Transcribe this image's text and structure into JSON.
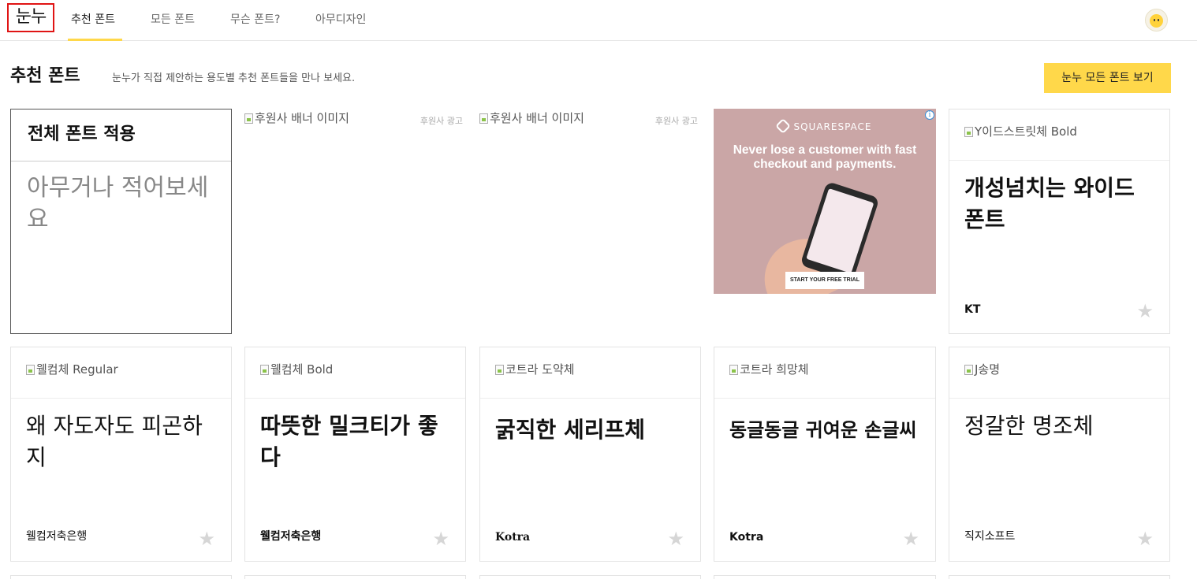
{
  "header": {
    "logo": "눈누",
    "tabs": [
      {
        "label": "추천 폰트",
        "active": true
      },
      {
        "label": "모든 폰트",
        "active": false
      },
      {
        "label": "무슨 폰트?",
        "active": false
      },
      {
        "label": "아무디자인",
        "active": false
      }
    ],
    "avatar": "user-avatar"
  },
  "section": {
    "title": "추천 폰트",
    "description": "눈누가 직접 제안하는 용도별 추천 폰트들을 만나 보세요.",
    "button_label": "눈누 모든 폰트 보기"
  },
  "apply_card": {
    "title": "전체 폰트 적용",
    "placeholder": "아무거나 적어보세요"
  },
  "sponsors": [
    {
      "alt": "후원사 배너 이미지",
      "label": "후원사 광고"
    },
    {
      "alt": "후원사 배너 이미지",
      "label": "후원사 광고"
    }
  ],
  "ad": {
    "brand": "SQUARESPACE",
    "headline": "Never lose a customer with fast checkout and payments.",
    "cta": "START YOUR FREE TRIAL",
    "info_icon": "i"
  },
  "cards": [
    {
      "img_alt": "Y이드스트릿체 Bold",
      "sample": "개성넘치는 와이드 폰트",
      "maker": "KT"
    },
    {
      "img_alt": "웰컴체 Regular",
      "sample": "왜 자도자도 피곤하지",
      "maker": "웰컴저축은행"
    },
    {
      "img_alt": "웰컴체 Bold",
      "sample": "따뜻한 밀크티가 좋다",
      "maker": "웰컴저축은행"
    },
    {
      "img_alt": "코트라 도약체",
      "sample": "굵직한 세리프체",
      "maker": "Kotra"
    },
    {
      "img_alt": "코트라 희망체",
      "sample": "동글동글 귀여운 손글씨",
      "maker": "Kotra"
    },
    {
      "img_alt": "J송명",
      "sample": "정갈한 명조체",
      "maker": "직지소프트"
    }
  ],
  "star_icon": "★",
  "colors": {
    "accent": "#ffd84a",
    "logo_border": "#e01414",
    "ad_background": "#caa6a6"
  }
}
